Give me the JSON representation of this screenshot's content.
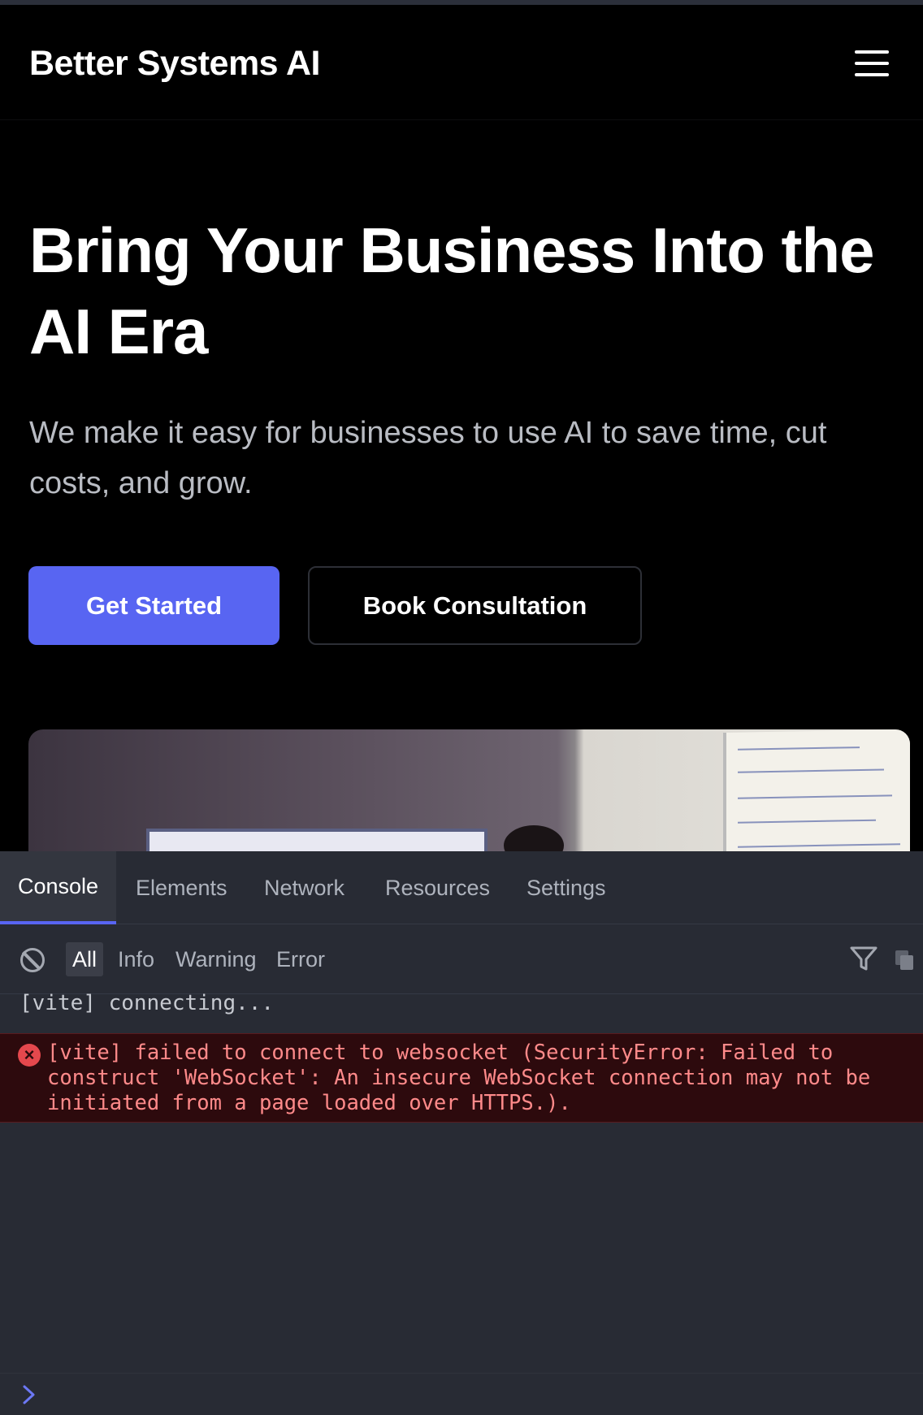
{
  "site": {
    "brand": "Better Systems AI",
    "menu_icon": "hamburger-menu-icon"
  },
  "hero": {
    "title": "Bring Your Business Into the AI Era",
    "subtitle": "We make it easy for businesses to use AI to save time, cut costs, and grow.",
    "primary_button": "Get Started",
    "secondary_button": "Book Consultation"
  },
  "colors": {
    "accent": "#5865f2",
    "background": "#000000",
    "devtools_bg": "#282b34",
    "error_bg": "#2d0a0d",
    "error_text": "#ff8a8a"
  },
  "devtools": {
    "tabs": [
      "Console",
      "Elements",
      "Network",
      "Resources",
      "Settings"
    ],
    "active_tab": "Console",
    "filters": [
      "All",
      "Info",
      "Warning",
      "Error"
    ],
    "active_filter": "All",
    "logs": [
      {
        "level": "log",
        "text": "[vite] connecting..."
      },
      {
        "level": "error",
        "text": "[vite] failed to connect to websocket (SecurityError: Failed to\nconstruct 'WebSocket': An insecure WebSocket connection may not be\ninitiated from a page loaded over HTTPS.)."
      }
    ],
    "icons": {
      "clear": "clear-console-icon",
      "filter": "filter-icon",
      "copy": "copy-icon",
      "prompt": "chevron-right-icon",
      "error": "error-circle-icon"
    }
  }
}
